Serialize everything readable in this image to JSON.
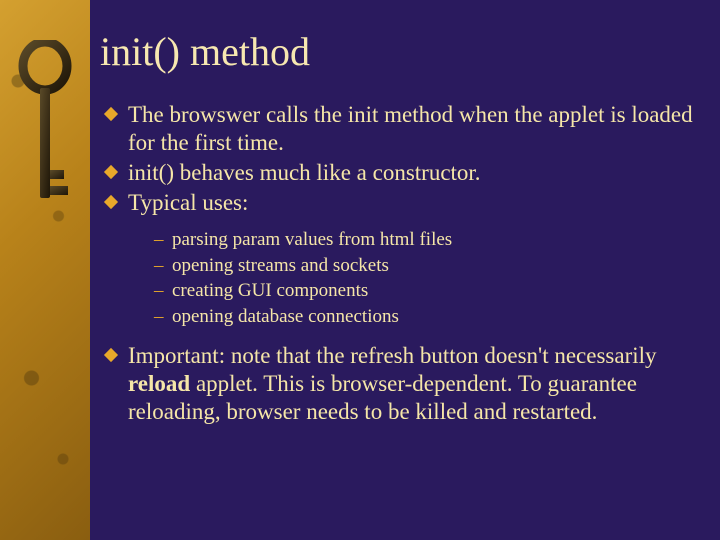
{
  "title": "init() method",
  "bullets": {
    "b1": "The browswer calls the init method when the applet is loaded for the first time.",
    "b2": "init() behaves much like a constructor.",
    "b3": "Typical uses:",
    "b4_pre": "Important: note that the refresh button doesn't necessarily ",
    "b4_bold": "reload",
    "b4_post": " applet. This is browser-dependent.  To guarantee reloading, browser needs to be killed and restarted."
  },
  "sub": {
    "s1": "parsing param values from html files",
    "s2": "opening streams and sockets",
    "s3": "creating GUI components",
    "s4": "opening database connections"
  }
}
